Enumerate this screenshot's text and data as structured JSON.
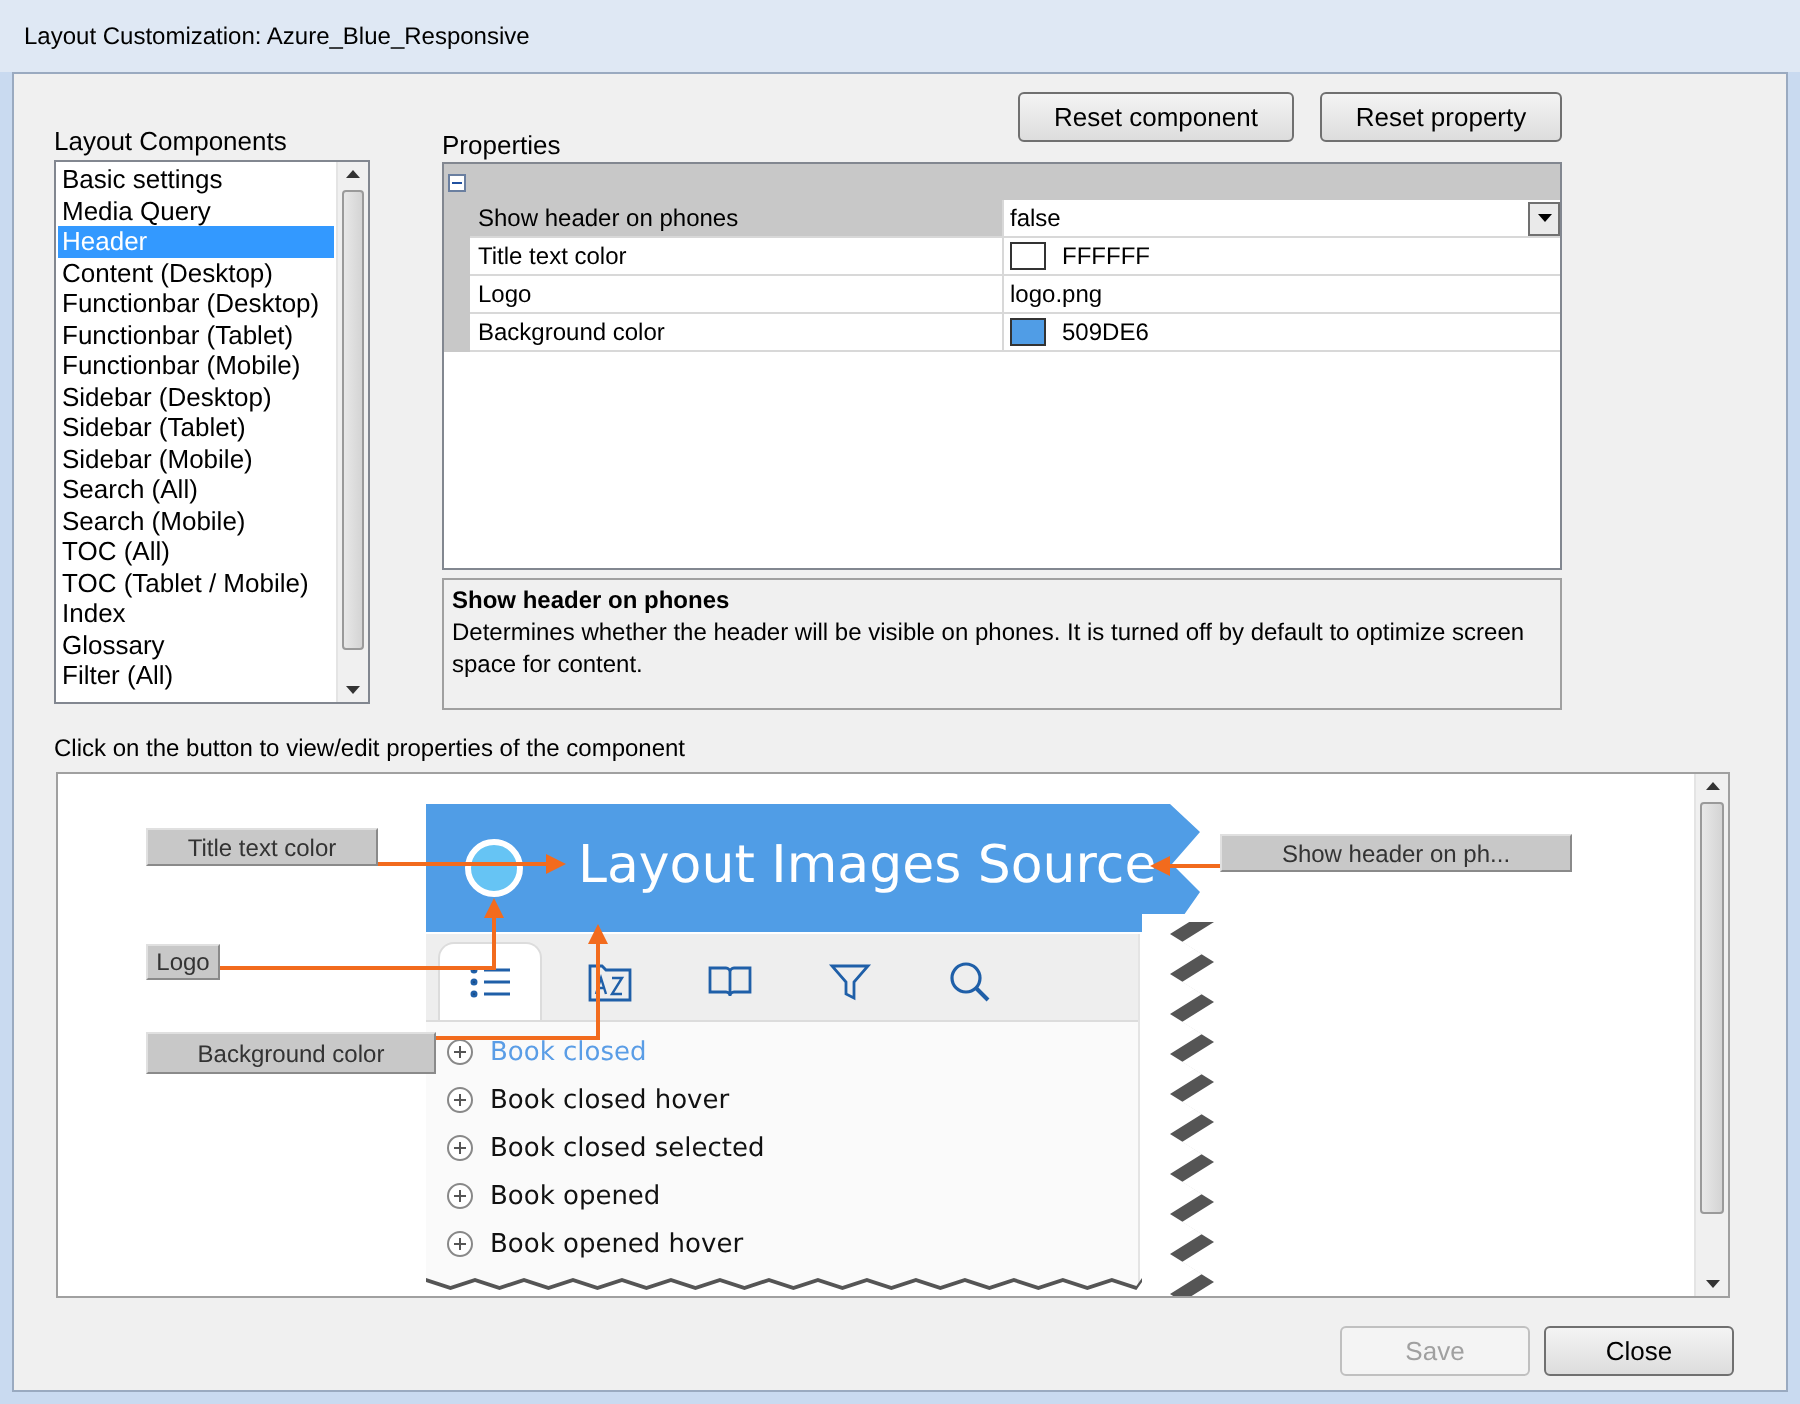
{
  "window": {
    "title": "Layout Customization: Azure_Blue_Responsive"
  },
  "components": {
    "label": "Layout Components",
    "items": [
      {
        "label": "Basic settings",
        "selected": false
      },
      {
        "label": "Media Query",
        "selected": false
      },
      {
        "label": "Header",
        "selected": true
      },
      {
        "label": "Content (Desktop)",
        "selected": false
      },
      {
        "label": "Functionbar (Desktop)",
        "selected": false
      },
      {
        "label": "Functionbar (Tablet)",
        "selected": false
      },
      {
        "label": "Functionbar (Mobile)",
        "selected": false
      },
      {
        "label": "Sidebar (Desktop)",
        "selected": false
      },
      {
        "label": "Sidebar (Tablet)",
        "selected": false
      },
      {
        "label": "Sidebar (Mobile)",
        "selected": false
      },
      {
        "label": "Search (All)",
        "selected": false
      },
      {
        "label": "Search (Mobile)",
        "selected": false
      },
      {
        "label": "TOC (All)",
        "selected": false
      },
      {
        "label": "TOC (Tablet / Mobile)",
        "selected": false
      },
      {
        "label": "Index",
        "selected": false
      },
      {
        "label": "Glossary",
        "selected": false
      },
      {
        "label": "Filter (All)",
        "selected": false
      }
    ]
  },
  "top_buttons": [
    {
      "label": "Reset component"
    },
    {
      "label": "Reset property"
    }
  ],
  "properties": {
    "label": "Properties",
    "rows": [
      {
        "name": "Show header on phones",
        "value": "false",
        "kind": "dropdown",
        "selected": true
      },
      {
        "name": "Title text color",
        "value": "FFFFFF",
        "kind": "color",
        "color": "#ffffff",
        "selected": false
      },
      {
        "name": "Logo",
        "value": "logo.png",
        "kind": "text",
        "selected": false
      },
      {
        "name": "Background color",
        "value": "509DE6",
        "kind": "color",
        "color": "#509de6",
        "selected": false
      }
    ],
    "description": {
      "title": "Show header on phones",
      "text": "Determines whether the header will be visible on phones. It is turned off by default to optimize screen space for content."
    }
  },
  "preview": {
    "instruction": "Click on the button to view/edit properties of the component",
    "header_title": "Layout Images Source",
    "tabs": [
      {
        "selected": true
      },
      {
        "selected": false
      },
      {
        "selected": false
      },
      {
        "selected": false
      },
      {
        "selected": false
      }
    ],
    "toc_items": [
      {
        "label": "Book closed",
        "selected": true
      },
      {
        "label": "Book closed hover",
        "selected": false
      },
      {
        "label": "Book closed selected",
        "selected": false
      },
      {
        "label": "Book opened",
        "selected": false
      },
      {
        "label": "Book opened hover",
        "selected": false
      }
    ],
    "callouts": [
      {
        "label": "Title text color"
      },
      {
        "label": "Logo"
      },
      {
        "label": "Background color"
      },
      {
        "label": "Show header on ph..."
      }
    ]
  },
  "footer_buttons": [
    {
      "label": "Save",
      "disabled": true
    },
    {
      "label": "Close",
      "disabled": false
    }
  ]
}
